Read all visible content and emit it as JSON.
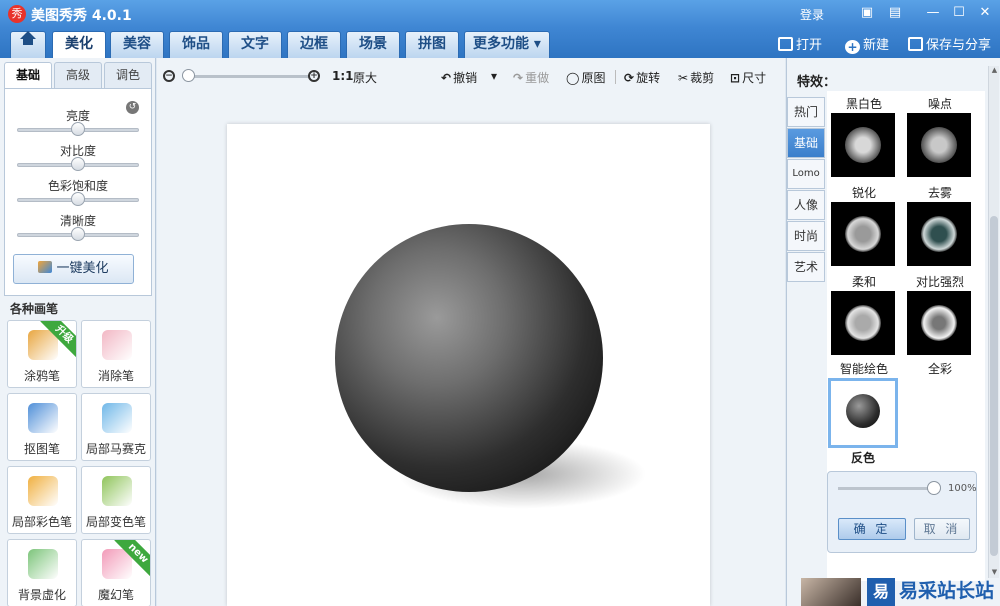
{
  "app": {
    "title": "美图秀秀 4.0.1",
    "logo_char": "秀",
    "login_label": "登录"
  },
  "window_controls": {
    "feedback_icon": "chat-icon",
    "skin_icon": "skin-icon",
    "min_icon": "minimize-icon",
    "max_icon": "maximize-icon",
    "close_icon": "close-icon"
  },
  "tabs": [
    {
      "label": "美化"
    },
    {
      "label": "美容"
    },
    {
      "label": "饰品"
    },
    {
      "label": "文字"
    },
    {
      "label": "边框"
    },
    {
      "label": "场景"
    },
    {
      "label": "拼图"
    },
    {
      "label": "更多功能 ▾"
    }
  ],
  "top_actions": {
    "open_label": "打开",
    "new_label": "新建",
    "save_label": "保存与分享"
  },
  "left_panel": {
    "subtabs": [
      {
        "label": "基础"
      },
      {
        "label": "高级"
      },
      {
        "label": "调色"
      }
    ],
    "sliders": [
      {
        "label": "亮度",
        "value": 0.5
      },
      {
        "label": "对比度",
        "value": 0.5
      },
      {
        "label": "色彩饱和度",
        "value": 0.5
      },
      {
        "label": "清晰度",
        "value": 0.5
      }
    ],
    "onekey_label": "一键美化",
    "brush_section_title": "各种画笔",
    "tools": [
      {
        "label": "涂鸦笔",
        "badge": "升级",
        "color": "#e8a640"
      },
      {
        "label": "消除笔",
        "badge": "",
        "color": "#f2b7c4"
      },
      {
        "label": "抠图笔",
        "badge": "",
        "color": "#4f8fd8"
      },
      {
        "label": "局部马赛克",
        "badge": "",
        "color": "#6fb7e8"
      },
      {
        "label": "局部彩色笔",
        "badge": "",
        "color": "#f0b040"
      },
      {
        "label": "局部变色笔",
        "badge": "",
        "color": "#8fc45a"
      },
      {
        "label": "背景虚化",
        "badge": "",
        "color": "#7cc47a"
      },
      {
        "label": "魔幻笔",
        "badge": "new",
        "color": "#f29ab8"
      }
    ]
  },
  "toolbar": {
    "zoom_value": 0.0,
    "ratio_label": "1:1",
    "original_size_label": "原大",
    "undo_label": "撤销",
    "redo_label": "重做",
    "original_label": "原图",
    "rotate_label": "旋转",
    "crop_label": "裁剪",
    "size_label": "尺寸"
  },
  "right_panel": {
    "title": "特效：",
    "categories": [
      {
        "label": "热门"
      },
      {
        "label": "基础"
      },
      {
        "label": "Lomo"
      },
      {
        "label": "人像"
      },
      {
        "label": "时尚"
      },
      {
        "label": "艺术"
      }
    ],
    "effects": [
      {
        "label": "黑白色"
      },
      {
        "label": "噪点"
      },
      {
        "label": "锐化"
      },
      {
        "label": "去雾"
      },
      {
        "label": "柔和"
      },
      {
        "label": "对比强烈"
      },
      {
        "label": "智能绘色"
      },
      {
        "label": "全彩"
      },
      {
        "label": "反色"
      }
    ],
    "strength_value": 1.0,
    "strength_label": "100%",
    "ok_label": "确 定",
    "cancel_label": "取 消"
  },
  "watermark": {
    "logo_char": "易",
    "text": "易采站长站"
  }
}
